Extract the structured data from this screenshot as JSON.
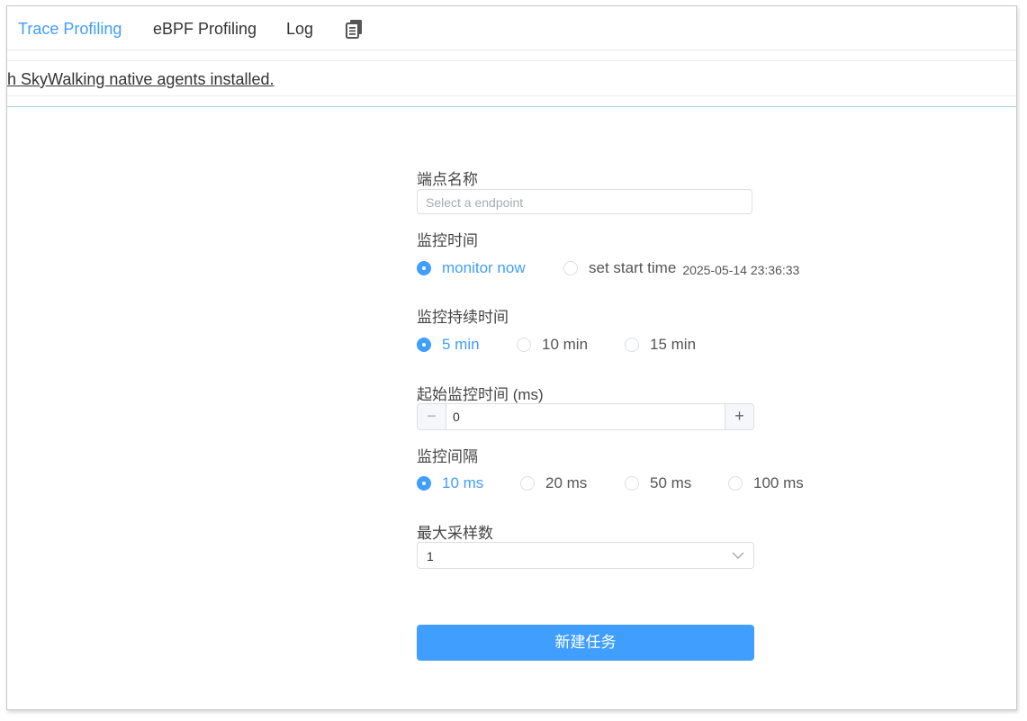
{
  "tabs": [
    {
      "label": "Trace Profiling",
      "active": true
    },
    {
      "label": "eBPF Profiling",
      "active": false
    },
    {
      "label": "Log",
      "active": false
    }
  ],
  "tab_icon": "copy-document-icon",
  "notice": {
    "text": "h SkyWalking native agents installed."
  },
  "form": {
    "endpoint": {
      "label": "端点名称",
      "placeholder": "Select a endpoint"
    },
    "monitor_time": {
      "label": "监控时间",
      "options": [
        "monitor now",
        "set start time"
      ],
      "selected": "monitor now",
      "start_time_value": "2025-05-14 23:36:33"
    },
    "duration": {
      "label": "监控持续时间",
      "options": [
        "5 min",
        "10 min",
        "15 min"
      ],
      "selected": "5 min"
    },
    "min_threshold": {
      "label": "起始监控时间 (ms)",
      "value": "0",
      "minus": "−",
      "plus": "+"
    },
    "interval": {
      "label": "监控间隔",
      "options": [
        "10 ms",
        "20 ms",
        "50 ms",
        "100 ms"
      ],
      "selected": "10 ms"
    },
    "max_samples": {
      "label": "最大采样数",
      "value": "1"
    },
    "submit_label": "新建任务"
  },
  "colors": {
    "accent": "#409eff",
    "border": "#dcdfe6"
  }
}
